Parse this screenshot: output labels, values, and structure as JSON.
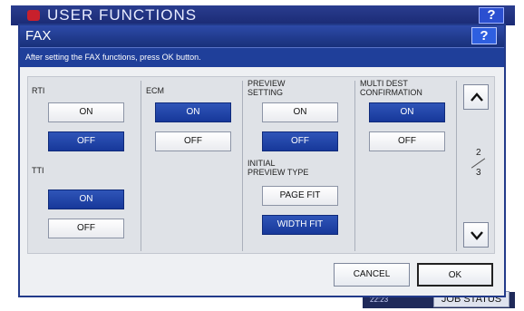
{
  "background_app": {
    "title": "USER FUNCTIONS",
    "help_label": "?",
    "time": "22:23",
    "job_status_label": "JOB STATUS"
  },
  "dialog": {
    "title": "FAX",
    "help_label": "?",
    "message": "After setting the FAX functions, press OK button."
  },
  "settings": {
    "rti": {
      "label": "RTI",
      "on": "ON",
      "off": "OFF",
      "selected": "OFF"
    },
    "tti": {
      "label": "TTI",
      "on": "ON",
      "off": "OFF",
      "selected": "ON"
    },
    "ecm": {
      "label": "ECM",
      "on": "ON",
      "off": "OFF",
      "selected": "ON"
    },
    "preview_setting": {
      "label_line1": "PREVIEW",
      "label_line2": "SETTING",
      "on": "ON",
      "off": "OFF",
      "selected": "OFF"
    },
    "initial_preview_type": {
      "label_line1": "INITIAL",
      "label_line2": "PREVIEW TYPE",
      "page_fit": "PAGE FIT",
      "width_fit": "WIDTH FIT",
      "selected": "WIDTH FIT"
    },
    "multi_dest_confirmation": {
      "label_line1": "MULTI DEST",
      "label_line2": "CONFIRMATION",
      "on": "ON",
      "off": "OFF",
      "selected": "ON"
    }
  },
  "pager": {
    "current": "2",
    "total": "3"
  },
  "footer": {
    "cancel_label": "CANCEL",
    "ok_label": "OK"
  },
  "colors": {
    "selected": "#1f3f9a",
    "titlebar": "#2d4aa8"
  }
}
